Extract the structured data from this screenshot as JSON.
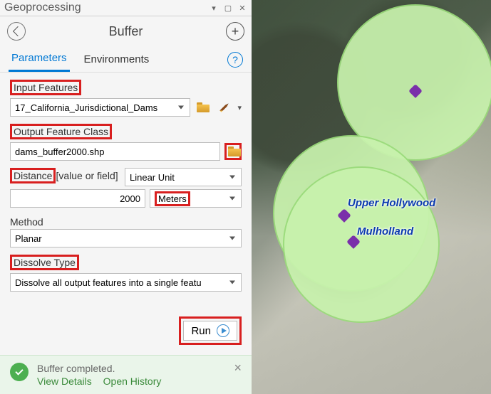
{
  "titlebar": {
    "title": "Geoprocessing"
  },
  "tool": {
    "name": "Buffer",
    "tabs": {
      "active": "Parameters",
      "other": "Environments"
    }
  },
  "form": {
    "input_features": {
      "label": "Input Features",
      "value": "17_California_Jurisdictional_Dams"
    },
    "output_feature_class": {
      "label": "Output Feature Class",
      "value": "dams_buffer2000.shp"
    },
    "distance": {
      "label": "Distance [value or field]",
      "source": "Linear Unit",
      "value": "2000",
      "unit": "Meters"
    },
    "method": {
      "label": "Method",
      "value": "Planar"
    },
    "dissolve": {
      "label": "Dissolve Type",
      "value": "Dissolve all output features into a single featu"
    }
  },
  "run": {
    "label": "Run"
  },
  "status": {
    "message": "Buffer completed.",
    "view_details": "View Details",
    "open_history": "Open History"
  },
  "map": {
    "labels": {
      "upper_hollywood": "Upper Hollywood",
      "mulholland": "Mulholland"
    }
  }
}
